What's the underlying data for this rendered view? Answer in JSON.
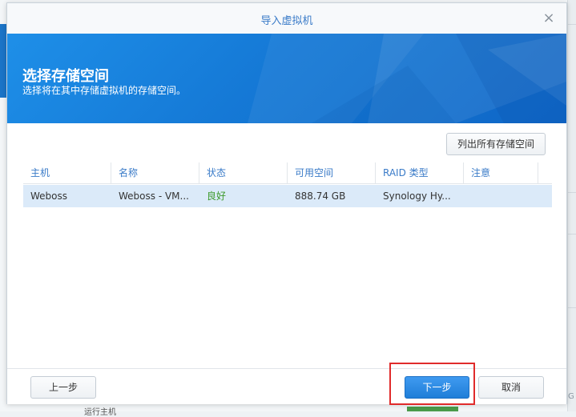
{
  "dialog": {
    "title": "导入虚拟机",
    "close_icon": "×",
    "banner": {
      "title": "选择存储空间",
      "subtitle": "选择将在其中存储虚拟机的存储空间。"
    },
    "list_all_button": "列出所有存储空间",
    "table": {
      "columns": [
        "主机",
        "名称",
        "状态",
        "可用空间",
        "RAID 类型",
        "注意"
      ],
      "rows": [
        {
          "host": "Weboss",
          "name": "Weboss - VM...",
          "status": "良好",
          "free_space": "888.74 GB",
          "raid": "Synology Hy...",
          "note": ""
        }
      ]
    },
    "footer": {
      "prev_button": "上一步",
      "next_button": "下一步",
      "cancel_button": "取消"
    }
  },
  "background": {
    "bottom_text": "运行主机",
    "right_text": "G"
  },
  "colors": {
    "accent": "#3a7bc8",
    "banner": "#1579d6",
    "status_ok": "#3d9a2b",
    "highlight": "#e02b2b",
    "row_selected": "#dbeaf9"
  }
}
